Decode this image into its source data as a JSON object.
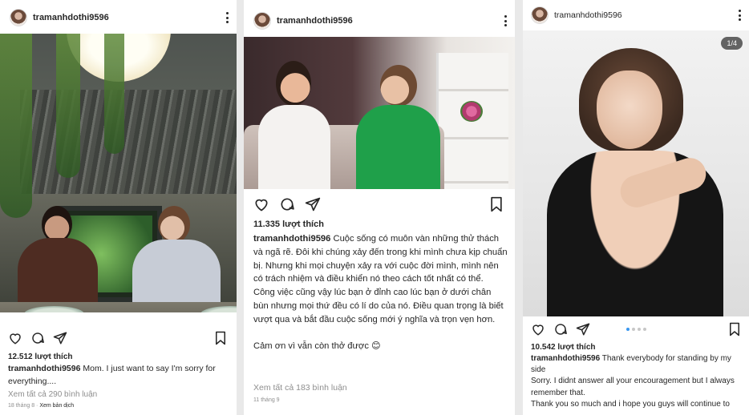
{
  "posts": [
    {
      "username": "tramanhdothi9596",
      "likes": "12.512 lượt thích",
      "caption_user": "tramanhdothi9596",
      "caption_text": " Mom. I just want to say I'm sorry for everything....",
      "view_comments": "Xem tất cả 290 bình luận",
      "date": "18 tháng 8",
      "see_translation": "Xem bản dịch"
    },
    {
      "username": "tramanhdothi9596",
      "likes": "11.335 lượt thích",
      "caption_user": "tramanhdothi9596",
      "caption_text": " Cuộc sống có muôn vàn những thử thách và ngã rẽ. Đôi khi chúng xảy đến trong khi mình chưa kịp chuẩn bị. Nhưng khi mọi chuyện xảy ra với cuộc đời mình, mình nên có trách nhiệm và điều khiển nó theo cách tốt nhất có thể.",
      "caption_p2": "Công việc cũng vậy lúc bạn ở đỉnh cao lúc bạn ở dưới chân bùn nhưng mọi thứ đều có lí do của nó. Điều quan trọng là biết vượt qua  và bắt đầu cuộc sống mới ý nghĩa và trọn vẹn hơn.",
      "caption_p3": "Cảm ơn vì vẫn còn thở được 😊",
      "view_comments": "Xem tất cả 183 bình luận",
      "date": "11 tháng 9"
    },
    {
      "username": "tramanhdothi9596",
      "badge": "1/4",
      "likes": "10.542 lượt thích",
      "caption_user": "tramanhdothi9596",
      "caption_text": " Thank everybody for standing by my side",
      "caption_p2": "Sorry.  I didnt answer all your encouragement but I always remember that.",
      "caption_p3": "Thank you so much and i hope you guys will continue to",
      "carousel_count": 4,
      "carousel_active": 1
    }
  ],
  "icons": {
    "like": "heart-icon",
    "comment": "comment-icon",
    "share": "share-icon",
    "save": "bookmark-icon",
    "menu": "more-options-icon"
  },
  "colors": {
    "text": "#262626",
    "muted": "#8e8e8e",
    "carousel_active": "#3897f0",
    "background": "#e9e9e9"
  }
}
